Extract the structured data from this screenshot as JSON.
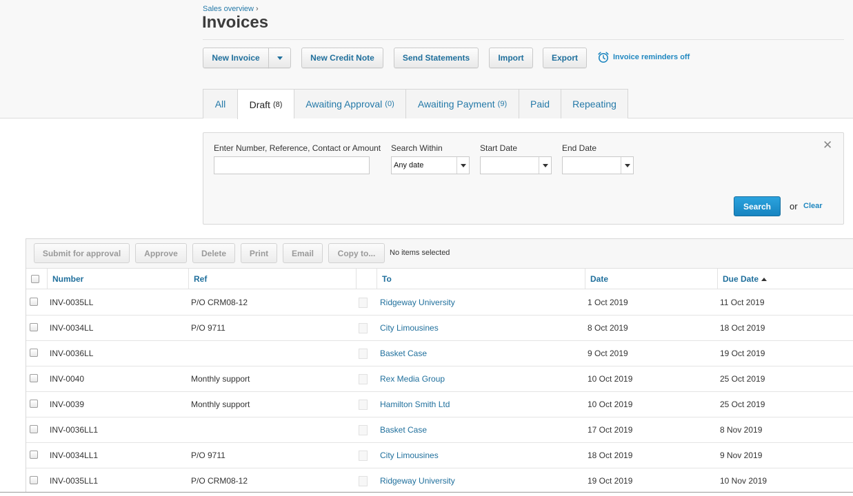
{
  "breadcrumb": {
    "link": "Sales overview",
    "separator": "›"
  },
  "page_title": "Invoices",
  "toolbar": {
    "new_invoice": "New Invoice",
    "new_credit_note": "New Credit Note",
    "send_statements": "Send Statements",
    "import": "Import",
    "export": "Export",
    "reminders": "Invoice reminders off"
  },
  "tabs": [
    {
      "label": "All",
      "count": ""
    },
    {
      "label": "Draft",
      "count": "(8)"
    },
    {
      "label": "Awaiting Approval",
      "count": "(0)"
    },
    {
      "label": "Awaiting Payment",
      "count": "(9)"
    },
    {
      "label": "Paid",
      "count": ""
    },
    {
      "label": "Repeating",
      "count": ""
    }
  ],
  "active_tab": "Draft",
  "search": {
    "query_label": "Enter Number, Reference, Contact or Amount",
    "query_value": "",
    "within_label": "Search Within",
    "within_value": "Any date",
    "start_label": "Start Date",
    "start_value": "",
    "end_label": "End Date",
    "end_value": "",
    "search_button": "Search",
    "or_text": "or",
    "clear_link": "Clear"
  },
  "actions": {
    "submit": "Submit for approval",
    "approve": "Approve",
    "delete": "Delete",
    "print": "Print",
    "email": "Email",
    "copy": "Copy to...",
    "selection_status": "No items selected"
  },
  "table": {
    "columns": {
      "number": "Number",
      "ref": "Ref",
      "to": "To",
      "date": "Date",
      "due_date": "Due Date"
    },
    "sort_column": "Due Date",
    "rows": [
      {
        "number": "INV-0035LL",
        "ref": "P/O CRM08-12",
        "to": "Ridgeway University",
        "date": "1 Oct 2019",
        "due": "11 Oct 2019"
      },
      {
        "number": "INV-0034LL",
        "ref": "P/O 9711",
        "to": "City Limousines",
        "date": "8 Oct 2019",
        "due": "18 Oct 2019"
      },
      {
        "number": "INV-0036LL",
        "ref": "",
        "to": "Basket Case",
        "date": "9 Oct 2019",
        "due": "19 Oct 2019"
      },
      {
        "number": "INV-0040",
        "ref": "Monthly support",
        "to": "Rex Media Group",
        "date": "10 Oct 2019",
        "due": "25 Oct 2019"
      },
      {
        "number": "INV-0039",
        "ref": "Monthly support",
        "to": "Hamilton Smith Ltd",
        "date": "10 Oct 2019",
        "due": "25 Oct 2019"
      },
      {
        "number": "INV-0036LL1",
        "ref": "",
        "to": "Basket Case",
        "date": "17 Oct 2019",
        "due": "8 Nov 2019"
      },
      {
        "number": "INV-0034LL1",
        "ref": "P/O 9711",
        "to": "City Limousines",
        "date": "18 Oct 2019",
        "due": "9 Nov 2019"
      },
      {
        "number": "INV-0035LL1",
        "ref": "P/O CRM08-12",
        "to": "Ridgeway University",
        "date": "19 Oct 2019",
        "due": "10 Nov 2019"
      }
    ]
  },
  "colors": {
    "link": "#1f6f9c",
    "accent": "#1784c0"
  }
}
